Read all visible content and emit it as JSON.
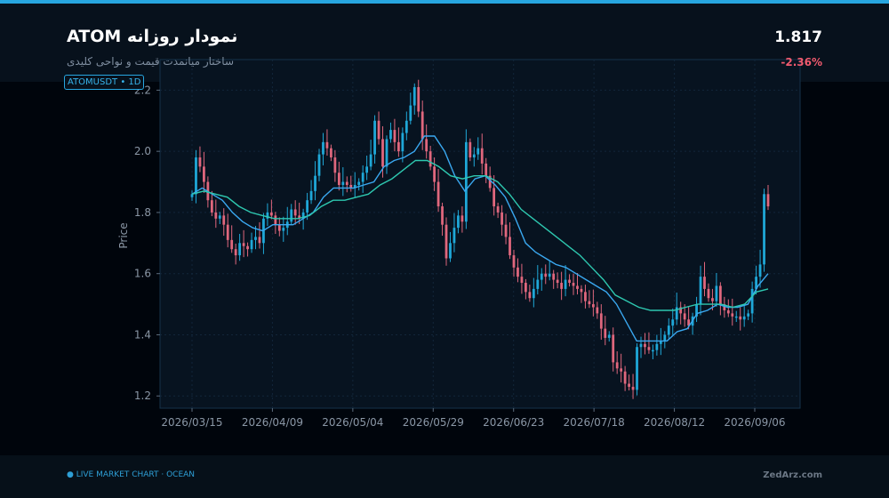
{
  "header": {
    "title": "ATOM نمودار روزانه",
    "subtitle": "ساختار میانمدت قیمت و نواحی کلیدی",
    "price": "1.817",
    "change": "-2.36%",
    "symbol_tag": "ATOMUSDT   •   1D"
  },
  "footer": {
    "live": "●  LIVE MARKET CHART   ·   OCEAN",
    "brand": "ZedArz.com"
  },
  "colors": {
    "accent": "#27a6e0",
    "up": "#1fa8d8",
    "down": "#e0677d",
    "ma_fast": "#3aa8f0",
    "ma_slow": "#2ec8b0",
    "change": "#f05a6e"
  },
  "chart_data": {
    "type": "candlestick",
    "ylabel": "Price",
    "ylim": [
      1.16,
      2.3
    ],
    "yticks": [
      1.2,
      1.4,
      1.6,
      1.8,
      2.0,
      2.2
    ],
    "xticks": [
      "2026/03/15",
      "2026/04/09",
      "2026/05/04",
      "2026/05/29",
      "2026/06/23",
      "2026/07/18",
      "2026/08/12",
      "2026/09/06"
    ],
    "x_start": "2026/03/15",
    "x_end": "2026/09/11",
    "close_series": [
      1.86,
      1.98,
      1.95,
      1.9,
      1.84,
      1.8,
      1.78,
      1.79,
      1.76,
      1.71,
      1.68,
      1.66,
      1.7,
      1.69,
      1.68,
      1.71,
      1.72,
      1.7,
      1.78,
      1.8,
      1.79,
      1.76,
      1.74,
      1.75,
      1.77,
      1.81,
      1.79,
      1.78,
      1.8,
      1.84,
      1.87,
      1.92,
      1.99,
      2.03,
      2.01,
      1.98,
      1.93,
      1.89,
      1.9,
      1.89,
      1.88,
      1.89,
      1.9,
      1.93,
      1.95,
      1.99,
      2.1,
      2.04,
      1.95,
      2.04,
      2.07,
      2.03,
      2.0,
      2.06,
      2.1,
      2.15,
      2.21,
      2.13,
      2.04,
      2.0,
      1.95,
      1.9,
      1.82,
      1.76,
      1.65,
      1.7,
      1.75,
      1.79,
      1.77,
      2.03,
      1.98,
      1.99,
      2.01,
      1.96,
      1.92,
      1.88,
      1.82,
      1.8,
      1.76,
      1.72,
      1.66,
      1.62,
      1.59,
      1.57,
      1.54,
      1.52,
      1.55,
      1.58,
      1.6,
      1.59,
      1.6,
      1.58,
      1.57,
      1.55,
      1.58,
      1.57,
      1.56,
      1.55,
      1.54,
      1.51,
      1.5,
      1.49,
      1.47,
      1.42,
      1.39,
      1.4,
      1.31,
      1.29,
      1.28,
      1.24,
      1.23,
      1.22,
      1.36,
      1.37,
      1.36,
      1.35,
      1.35,
      1.37,
      1.38,
      1.4,
      1.43,
      1.45,
      1.49,
      1.47,
      1.45,
      1.43,
      1.46,
      1.5,
      1.59,
      1.55,
      1.52,
      1.51,
      1.56,
      1.5,
      1.48,
      1.47,
      1.46,
      1.46,
      1.45,
      1.46,
      1.47,
      1.55,
      1.59,
      1.63,
      1.86,
      1.82
    ],
    "series": [
      {
        "name": "MA fast",
        "values": [
          1.86,
          1.88,
          1.86,
          1.84,
          1.8,
          1.77,
          1.75,
          1.74,
          1.76,
          1.76,
          1.76,
          1.78,
          1.8,
          1.85,
          1.88,
          1.88,
          1.88,
          1.89,
          1.9,
          1.95,
          1.97,
          1.98,
          2.0,
          2.05,
          2.05,
          2.0,
          1.92,
          1.87,
          1.91,
          1.92,
          1.89,
          1.85,
          1.78,
          1.7,
          1.67,
          1.65,
          1.63,
          1.62,
          1.6,
          1.58,
          1.56,
          1.54,
          1.5,
          1.44,
          1.38,
          1.38,
          1.38,
          1.38,
          1.41,
          1.42,
          1.47,
          1.48,
          1.5,
          1.49,
          1.49,
          1.5,
          1.56,
          1.6
        ]
      },
      {
        "name": "MA slow",
        "values": [
          1.86,
          1.87,
          1.86,
          1.85,
          1.82,
          1.8,
          1.79,
          1.78,
          1.78,
          1.78,
          1.79,
          1.82,
          1.84,
          1.84,
          1.85,
          1.86,
          1.89,
          1.91,
          1.94,
          1.97,
          1.97,
          1.95,
          1.92,
          1.91,
          1.92,
          1.92,
          1.9,
          1.86,
          1.81,
          1.78,
          1.75,
          1.72,
          1.69,
          1.66,
          1.62,
          1.58,
          1.53,
          1.51,
          1.49,
          1.48,
          1.48,
          1.48,
          1.49,
          1.5,
          1.5,
          1.5,
          1.49,
          1.5,
          1.54,
          1.55
        ]
      }
    ]
  }
}
